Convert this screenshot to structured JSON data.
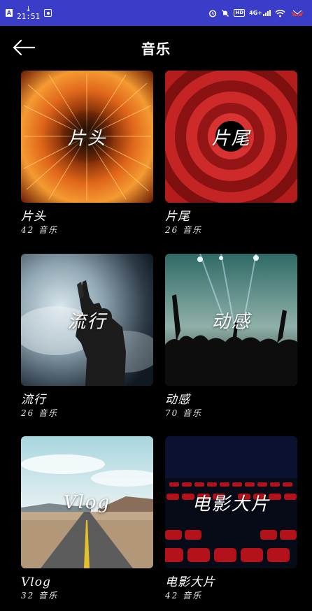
{
  "status_bar": {
    "app_badge": "A",
    "download_glyph": "↓",
    "time": "21:51",
    "network_label": "4G+",
    "hd_label": "HD",
    "background": "#3a3dc7"
  },
  "header": {
    "title": "音乐",
    "back_icon": "arrow-left-icon"
  },
  "categories": [
    {
      "thumb_label": "片头",
      "title": "片头",
      "count": "42 音乐",
      "theme": "fire-burst"
    },
    {
      "thumb_label": "片尾",
      "title": "片尾",
      "count": "26 音乐",
      "theme": "red-rings"
    },
    {
      "thumb_label": "流行",
      "title": "流行",
      "count": "26 音乐",
      "theme": "concert-smoke"
    },
    {
      "thumb_label": "动感",
      "title": "动感",
      "count": "70 音乐",
      "theme": "concert-crowd"
    },
    {
      "thumb_label": "Vlog",
      "title": "Vlog",
      "count": "32 音乐",
      "theme": "desert-road"
    },
    {
      "thumb_label": "电影大片",
      "title": "电影大片",
      "count": "42 音乐",
      "theme": "cinema-seats"
    }
  ]
}
